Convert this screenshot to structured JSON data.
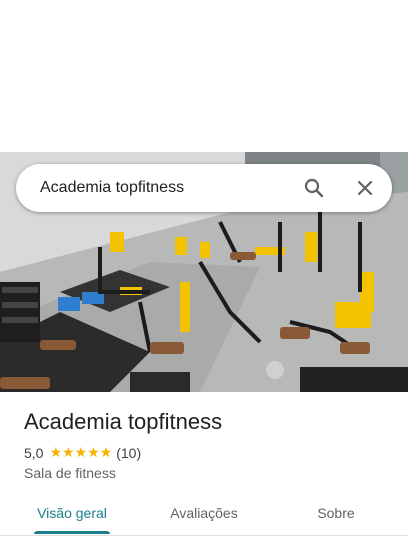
{
  "search": {
    "query": "Academia topfitness"
  },
  "place": {
    "name": "Academia topfitness",
    "rating": "5,0",
    "stars": "★★★★★",
    "review_count": "(10)",
    "category": "Sala de fitness"
  },
  "tabs": [
    {
      "label": "Visão geral",
      "active": true
    },
    {
      "label": "Avaliações",
      "active": false
    },
    {
      "label": "Sobre",
      "active": false
    }
  ],
  "colors": {
    "accent": "#1a7f89",
    "stars": "#f5b400",
    "equipment": "#f2c300"
  },
  "icons": [
    "search-icon",
    "close-icon"
  ]
}
